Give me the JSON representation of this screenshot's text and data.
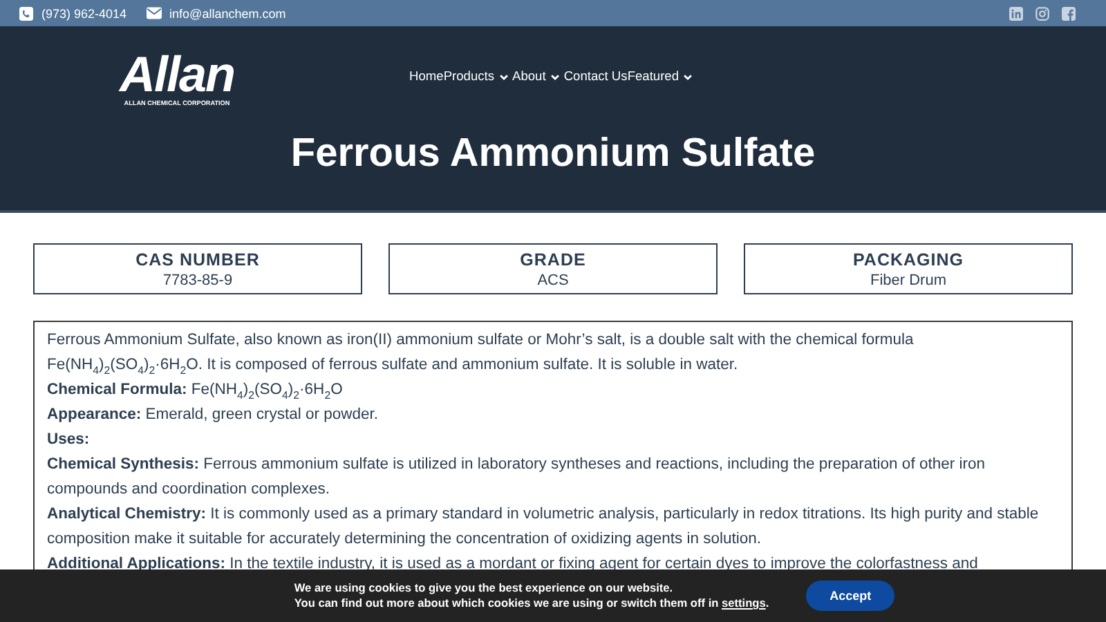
{
  "top_bar": {
    "phone": "(973) 962-4014",
    "email": "info@allanchem.com"
  },
  "header": {
    "logo": {
      "name": "Allan",
      "tagline": "ALLAN CHEMICAL CORPORATION"
    },
    "nav": [
      {
        "label": "Home",
        "dropdown": false
      },
      {
        "label": "Products",
        "dropdown": true
      },
      {
        "label": "About",
        "dropdown": true
      },
      {
        "label": "Contact Us",
        "dropdown": false
      },
      {
        "label": "Featured",
        "dropdown": true
      }
    ],
    "title": "Ferrous Ammonium Sulfate"
  },
  "cards": [
    {
      "heading": "CAS NUMBER",
      "value": "7783-85-9"
    },
    {
      "heading": "GRADE",
      "value": "ACS"
    },
    {
      "heading": "PACKAGING",
      "value": "Fiber Drum"
    }
  ],
  "description": [
    "Ferrous Ammonium Sulfate, also known as iron(II) ammonium sulfate or Mohr’s salt, is a double salt with the chemical formula Fe(NH$_{4}$)$_{2}$(SO$_{4}$)$_{2}$·6H$_{2}$O. It is composed of ferrous sulfate and ammonium sulfate. It is soluble in water.",
    "**Chemical Formula:** Fe(NH$_{4}$)$_{2}$(SO$_{4}$)$_{2}$·6H$_{2}$O",
    "**Appearance:** Emerald, green crystal or powder.",
    "**Uses:**",
    "**Chemical Synthesis:** Ferrous ammonium sulfate is utilized in laboratory syntheses and reactions, including the preparation of other iron compounds and coordination complexes.",
    "**Analytical Chemistry:** It is commonly used as a primary standard in volumetric analysis, particularly in redox titrations. Its high purity and stable composition make it suitable for accurately determining the concentration of oxidizing agents in solution.",
    "**Additional Applications:** In the textile industry, it is used as a mordant or fixing agent for certain dyes to improve the colorfastness and"
  ],
  "cookie_bar": {
    "line_1": "We are using cookies to give you the best experience on our website.",
    "line_2": "You can find out more about which cookies we are using or switch them off in",
    "link": "settings",
    "after_link": ".",
    "button": "Accept"
  }
}
